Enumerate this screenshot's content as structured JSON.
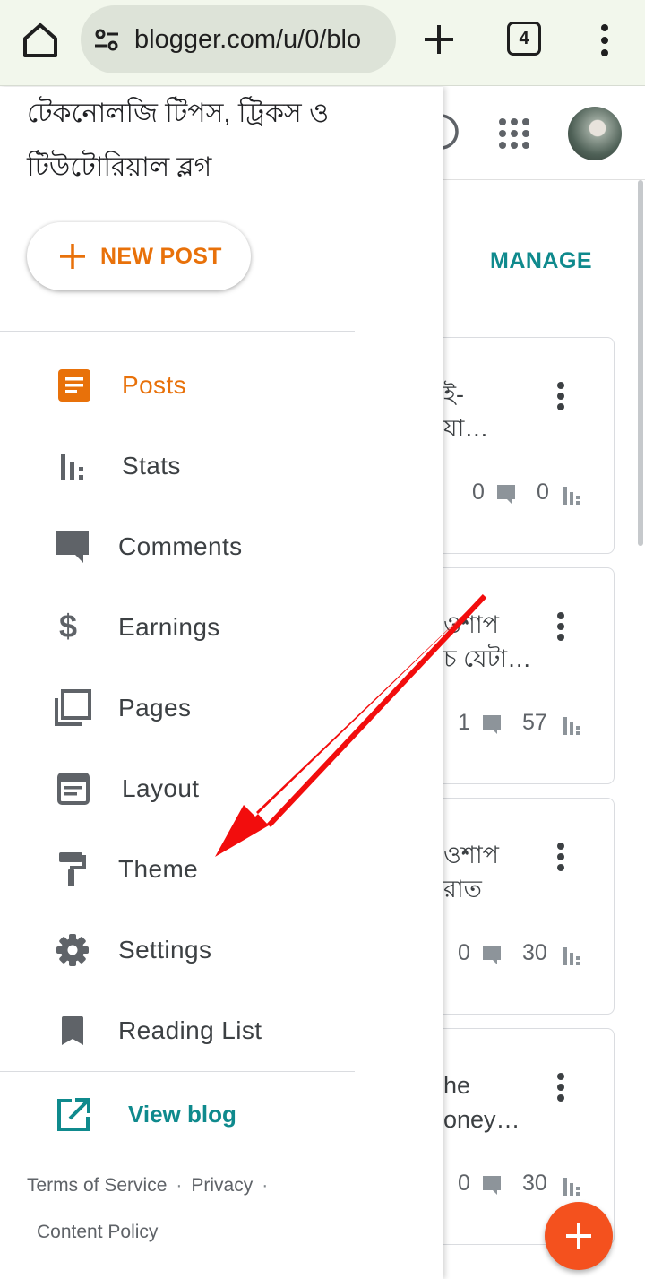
{
  "browser": {
    "url": "blogger.com/u/0/blo",
    "tab_count": "4"
  },
  "drawer": {
    "blog_title": "টেকনোলজি টিপস, ট্রিকস ও\nটিউটোরিয়াল ব্লগ",
    "new_post_label": "NEW POST",
    "nav": [
      {
        "label": "Posts",
        "icon": "posts-icon",
        "active": true
      },
      {
        "label": "Stats",
        "icon": "stats-icon"
      },
      {
        "label": "Comments",
        "icon": "comments-icon"
      },
      {
        "label": "Earnings",
        "icon": "earnings-icon"
      },
      {
        "label": "Pages",
        "icon": "pages-icon"
      },
      {
        "label": "Layout",
        "icon": "layout-icon"
      },
      {
        "label": "Theme",
        "icon": "theme-icon"
      },
      {
        "label": "Settings",
        "icon": "settings-icon"
      },
      {
        "label": "Reading List",
        "icon": "reading-list-icon"
      }
    ],
    "view_blog_label": "View blog",
    "footer": {
      "terms": "Terms of Service",
      "privacy": "Privacy",
      "content_policy": "Content Policy",
      "separator": "·"
    }
  },
  "page": {
    "manage_label": "MANAGE",
    "posts": [
      {
        "title": "ই-\nযা…",
        "comments": "0",
        "views": "0"
      },
      {
        "title": "ওশাপ\nচ যেটা…",
        "comments": "1",
        "views": "57"
      },
      {
        "title": "ওশাপ\n রাত",
        "comments": "0",
        "views": "30"
      },
      {
        "title": "he\noney…",
        "comments": "0",
        "views": "30"
      }
    ]
  },
  "colors": {
    "accent_orange": "#e8710a",
    "teal": "#0f8a8d",
    "fab": "#f4511e",
    "annotation_arrow": "#f20d0d"
  }
}
